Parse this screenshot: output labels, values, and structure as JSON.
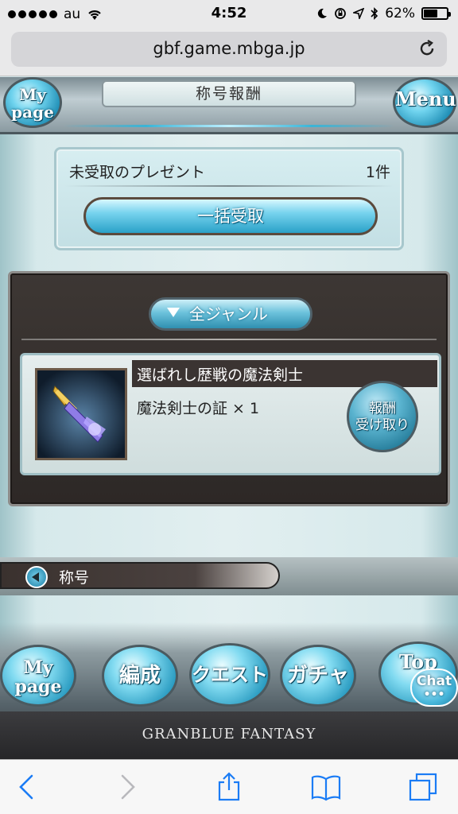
{
  "status_bar": {
    "carrier": "au",
    "time": "4:52",
    "battery_percent": "62%",
    "battery_level": 0.62
  },
  "browser": {
    "url": "gbf.game.mbga.jp"
  },
  "header": {
    "title": "称号報酬",
    "mypage_label_line1": "My",
    "mypage_label_line2": "page",
    "menu_label": "Menu"
  },
  "present": {
    "label": "未受取のプレゼント",
    "count": "1件",
    "bulk_receive_label": "一括受取"
  },
  "rewards": {
    "genre_filter_label": "全ジャンル",
    "items": [
      {
        "title": "選ばれし歴戦の魔法剣士",
        "description": "魔法剣士の証 × 1",
        "claim_label_line1": "報酬",
        "claim_label_line2": "受け取り"
      }
    ]
  },
  "title_nav": {
    "label": "称号"
  },
  "bottom_nav": {
    "mypage_line1": "My",
    "mypage_line2": "page",
    "hensei": "編成",
    "quest": "クエスト",
    "gacha": "ガチャ",
    "top": "Top",
    "chat": "Chat",
    "chat_dots": "•••",
    "logo": "GRANBLUE FANTASY"
  },
  "colors": {
    "accent_blue": "#2aa1c8",
    "panel_dark": "#2d2826",
    "toolbar_icon": "#1b7cf5"
  },
  "toolbar": {
    "icons": [
      "back-icon",
      "forward-icon",
      "share-icon",
      "bookmarks-icon",
      "tabs-icon"
    ]
  }
}
